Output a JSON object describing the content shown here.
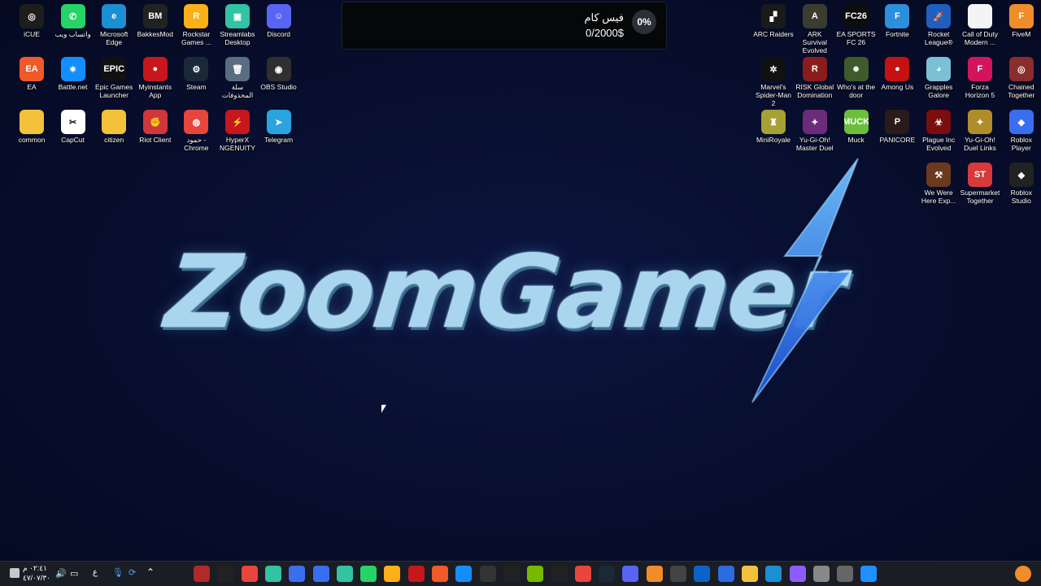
{
  "desktop": {
    "icons_left": [
      {
        "label": "iCUE",
        "color": "#1d1d1d",
        "glyph": "◎",
        "icon": "icue-icon"
      },
      {
        "label": "واتساب ويب",
        "color": "#25d366",
        "glyph": "✆",
        "icon": "whatsapp-icon"
      },
      {
        "label": "Microsoft Edge",
        "color": "#1b8fd2",
        "glyph": "e",
        "icon": "edge-icon"
      },
      {
        "label": "BakkesMod",
        "color": "#222222",
        "glyph": "BM",
        "icon": "bakkesmod-icon"
      },
      {
        "label": "Rockstar Games ...",
        "color": "#fcaf17",
        "glyph": "R",
        "icon": "rockstar-icon"
      },
      {
        "label": "Streamlabs Desktop",
        "color": "#31c3a2",
        "glyph": "▣",
        "icon": "streamlabs-icon"
      },
      {
        "label": "Discord",
        "color": "#5865f2",
        "glyph": "☺",
        "icon": "discord-icon"
      },
      {
        "label": "EA",
        "color": "#f05a28",
        "glyph": "EA",
        "icon": "ea-icon"
      },
      {
        "label": "Battle.net",
        "color": "#148eff",
        "glyph": "✷",
        "icon": "battlenet-icon"
      },
      {
        "label": "Epic Games Launcher",
        "color": "#111111",
        "glyph": "EPIC",
        "icon": "epic-games-icon"
      },
      {
        "label": "Myinstants App",
        "color": "#c8161d",
        "glyph": "●",
        "icon": "myinstants-icon"
      },
      {
        "label": "Steam",
        "color": "#1b2838",
        "glyph": "⚙",
        "icon": "steam-icon"
      },
      {
        "label": "سلة المحذوفات",
        "color": "#5a6d80",
        "glyph": "🗑",
        "icon": "recycle-bin-icon"
      },
      {
        "label": "OBS Studio",
        "color": "#302e31",
        "glyph": "◉",
        "icon": "obs-icon"
      },
      {
        "label": "common",
        "color": "#f3c13a",
        "glyph": "",
        "icon": "folder-icon"
      },
      {
        "label": "CapCut",
        "color": "#ffffff",
        "glyph": "✂",
        "icon": "capcut-icon"
      },
      {
        "label": "citizen",
        "color": "#f3c13a",
        "glyph": "",
        "icon": "folder-icon"
      },
      {
        "label": "Riot Client",
        "color": "#d13639",
        "glyph": "✊",
        "icon": "riot-client-icon"
      },
      {
        "label": "حمود - Chrome",
        "color": "#e8453c",
        "glyph": "◍",
        "icon": "chrome-icon"
      },
      {
        "label": "HyperX NGENUITY",
        "color": "#c8161d",
        "glyph": "⚡",
        "icon": "hyperx-icon"
      },
      {
        "label": "Telegram",
        "color": "#2aa3e0",
        "glyph": "➤",
        "icon": "telegram-icon"
      }
    ],
    "icons_right": [
      {
        "label": "ARC Raiders",
        "color": "#1a1a1a",
        "glyph": "▞",
        "icon": "arc-raiders-icon"
      },
      {
        "label": "ARK Survival Evolved",
        "color": "#3b3b2f",
        "glyph": "A",
        "icon": "ark-icon"
      },
      {
        "label": "EA SPORTS FC 26",
        "color": "#0d0d0d",
        "glyph": "FC26",
        "icon": "ea-fc-icon"
      },
      {
        "label": "Fortnite",
        "color": "#2c8fdc",
        "glyph": "F",
        "icon": "fortnite-icon"
      },
      {
        "label": "Rocket League®",
        "color": "#1f5fbf",
        "glyph": "🚀",
        "icon": "rocket-league-icon"
      },
      {
        "label": "Call of Duty Modern ...",
        "color": "#f4f4f4",
        "glyph": "",
        "icon": "cod-icon"
      },
      {
        "label": "FiveM",
        "color": "#f08c2a",
        "glyph": "F",
        "icon": "fivem-icon"
      },
      {
        "label": "Marvel's Spider-Man 2",
        "color": "#111111",
        "glyph": "✲",
        "icon": "spiderman-icon"
      },
      {
        "label": "RISK Global Domination",
        "color": "#8b1c1c",
        "glyph": "R",
        "icon": "risk-icon"
      },
      {
        "label": "Who's at the door",
        "color": "#3f5a2b",
        "glyph": "☻",
        "icon": "whos-at-door-icon"
      },
      {
        "label": "Among Us",
        "color": "#c51111",
        "glyph": "●",
        "icon": "among-us-icon"
      },
      {
        "label": "Grapples Galore",
        "color": "#7cc0d6",
        "glyph": "◕",
        "icon": "grapples-icon"
      },
      {
        "label": "Forza Horizon 5",
        "color": "#d4145a",
        "glyph": "F",
        "icon": "forza-icon"
      },
      {
        "label": "Chained Together",
        "color": "#8a2d2d",
        "glyph": "◎",
        "icon": "chained-together-icon"
      },
      {
        "label": "MiniRoyale",
        "color": "#a7a035",
        "glyph": "♜",
        "icon": "miniroyale-icon"
      },
      {
        "label": "Yu-Gi-Oh! Master Duel",
        "color": "#6b2b7a",
        "glyph": "✦",
        "icon": "yugioh-master-duel-icon"
      },
      {
        "label": "Muck",
        "color": "#6bbf3c",
        "glyph": "MUCK",
        "icon": "muck-icon"
      },
      {
        "label": "PANICORE",
        "color": "#2a1a1a",
        "glyph": "P",
        "icon": "panicore-icon"
      },
      {
        "label": "Plague Inc Evolved",
        "color": "#7a0d0d",
        "glyph": "☣",
        "icon": "plague-inc-icon"
      },
      {
        "label": "Yu-Gi-Oh! Duel Links",
        "color": "#b08d2a",
        "glyph": "✦",
        "icon": "yugioh-duel-links-icon"
      },
      {
        "label": "Roblox Player",
        "color": "#3a6df0",
        "glyph": "◆",
        "icon": "roblox-player-icon"
      },
      {
        "label": "We Were Here Exp...",
        "color": "#6b3a1e",
        "glyph": "⚒",
        "icon": "we-were-here-icon"
      },
      {
        "label": "Supermarket Together",
        "color": "#d63a3a",
        "glyph": "ST",
        "icon": "supermarket-together-icon"
      },
      {
        "label": "Roblox Studio",
        "color": "#222222",
        "glyph": "◆",
        "icon": "roblox-studio-icon"
      }
    ],
    "wallpaper_title": "ZoomGamer"
  },
  "notification": {
    "title": "فيس كام",
    "amount": "0/2000$",
    "percent": "0%"
  },
  "taskbar": {
    "clock_time": "٠٢:٤١ م",
    "clock_date": "٤٧/٠٧/٣٠",
    "lang": "ع",
    "items": [
      "news-icon",
      "epic-games-icon",
      "chrome-icon",
      "streamlabs-icon",
      "roblox-icon",
      "roblox-studio-icon",
      "streamlabs-icon",
      "whatsapp-icon",
      "rockstar-icon",
      "myinstants-icon",
      "ea-icon",
      "battlenet-icon",
      "capcut-icon",
      "bakkesmod-icon",
      "nvidia-icon",
      "epic-icon",
      "chrome-icon",
      "steam-icon",
      "discord-icon",
      "fivem-icon",
      "obs-icon",
      "outlook-icon",
      "store-icon",
      "file-explorer-icon",
      "edge-icon",
      "copilot-icon",
      "task-view-icon",
      "search-icon",
      "start-icon"
    ]
  }
}
